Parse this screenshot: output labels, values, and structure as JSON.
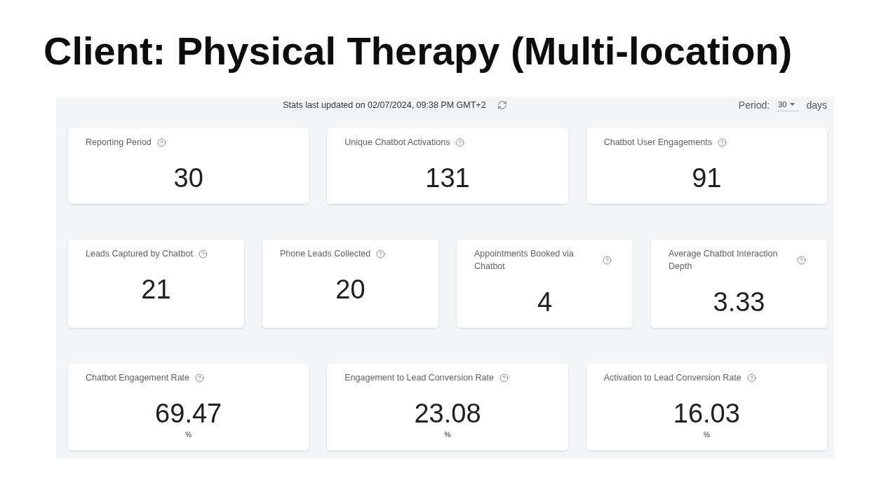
{
  "title": "Client: Physical Therapy (Multi-location)",
  "dashboard": {
    "last_updated": "Stats last updated on 02/07/2024, 09:38 PM GMT+2",
    "period": {
      "label": "Period:",
      "value": "30",
      "unit": "days"
    },
    "rows": [
      {
        "cards": [
          {
            "label": "Reporting Period",
            "value": "30"
          },
          {
            "label": "Unique Chatbot Activations",
            "value": "131"
          },
          {
            "label": "Chatbot User Engagements",
            "value": "91"
          }
        ]
      },
      {
        "cards": [
          {
            "label": "Leads Captured by Chatbot",
            "value": "21"
          },
          {
            "label": "Phone Leads Collected",
            "value": "20"
          },
          {
            "label": "Appointments Booked via Chatbot",
            "value": "4"
          },
          {
            "label": "Average Chatbot Interaction Depth",
            "value": "3.33"
          }
        ]
      },
      {
        "cards": [
          {
            "label": "Chatbot Engagement Rate",
            "value": "69.47",
            "unit": "%"
          },
          {
            "label": "Engagement to Lead Conversion Rate",
            "value": "23.08",
            "unit": "%"
          },
          {
            "label": "Activation to Lead Conversion Rate",
            "value": "16.03",
            "unit": "%"
          }
        ]
      }
    ]
  }
}
